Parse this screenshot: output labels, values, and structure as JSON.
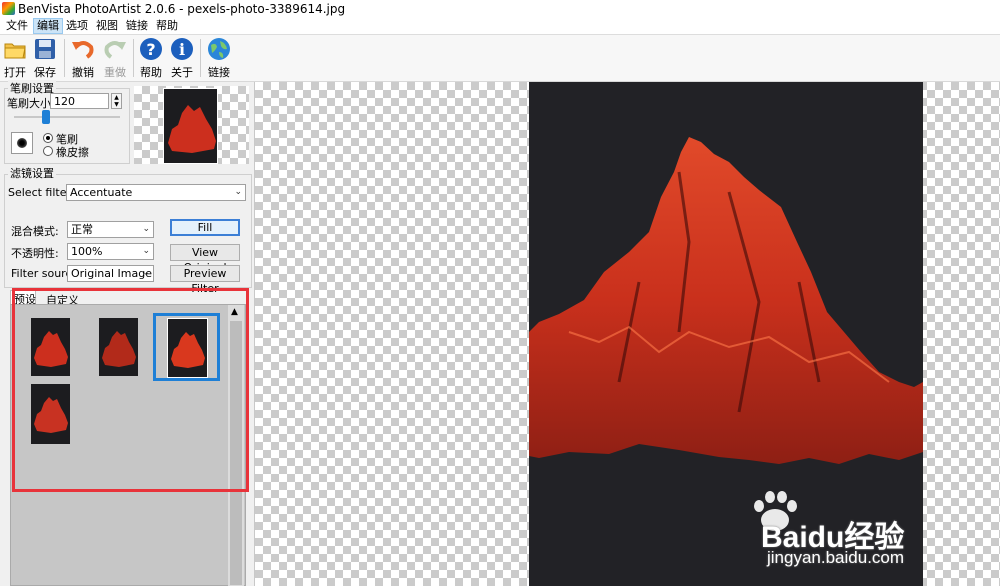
{
  "window": {
    "title": "BenVista PhotoArtist 2.0.6 - pexels-photo-3389614.jpg"
  },
  "menu": [
    "文件",
    "编辑",
    "选项",
    "视图",
    "链接",
    "帮助"
  ],
  "toolbar": {
    "open": "打开",
    "save": "保存",
    "undo": "撤销",
    "redo": "重做",
    "help": "帮助",
    "about": "关于",
    "link": "链接"
  },
  "brush": {
    "group_title": "笔刷设置",
    "size_label": "笔刷大小",
    "size_value": "120",
    "mode_brush": "笔刷",
    "mode_eraser": "橡皮擦",
    "selected_mode": "笔刷"
  },
  "filter": {
    "group_title": "滤镜设置",
    "select_label": "Select filter:",
    "selected_filter": "Accentuate",
    "blend_label": "混合模式:",
    "blend_value": "正常",
    "opacity_label": "不透明性:",
    "opacity_value": "100%",
    "source_label": "Filter source:",
    "source_value": "Original Image",
    "fill_button": "Fill",
    "view_original_button": "View Original",
    "preview_button": "Preview Filter"
  },
  "presets": {
    "tabs": [
      "预设",
      "自定义"
    ],
    "active_tab": "预设",
    "selected_index": 2,
    "count": 4
  },
  "watermark": {
    "brand": "Baidu经验",
    "url": "jingyan.baidu.com"
  },
  "colors": {
    "highlight": "#e8333a",
    "selection": "#1e7fd6",
    "photo_bg": "#222226",
    "mountain": "#d9381e"
  }
}
